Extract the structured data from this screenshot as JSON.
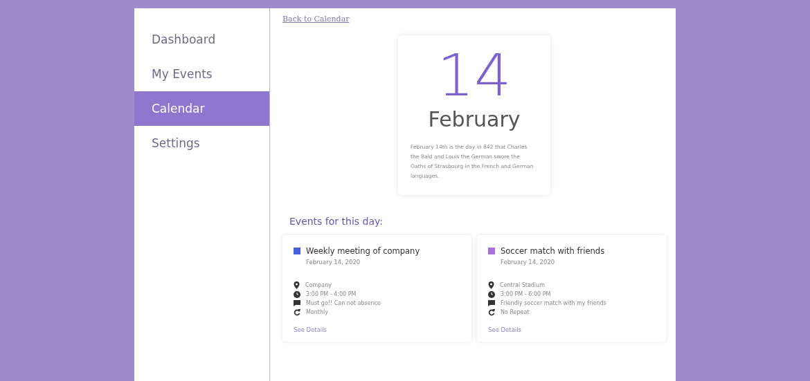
{
  "sidebar": {
    "items": [
      {
        "label": "Dashboard",
        "selected": false
      },
      {
        "label": "My Events",
        "selected": false
      },
      {
        "label": "Calendar",
        "selected": true
      },
      {
        "label": "Settings",
        "selected": false
      }
    ]
  },
  "back_link": "Back to Calendar",
  "day": {
    "number": "14",
    "month": "February",
    "description": "February 14th is the day in 842 that Charles the Bald and Louis the German swore the Oaths of Strasbourg in the French and German languages."
  },
  "events_heading": "Events for this day:",
  "events": [
    {
      "title": "Weekly meeting of company",
      "color": "#4a5fd6",
      "date": "February 14, 2020",
      "location": "Company",
      "time": "3:00 PM - 4:00 PM",
      "note": "Must go!! Can not absence",
      "repeat": "Monthly",
      "link": "See Details"
    },
    {
      "title": "Soccer match with friends",
      "color": "#a970e0",
      "date": "February 14, 2020",
      "location": "Central Stadium",
      "time": "3:00 PM - 6:00 PM",
      "note": "Friendly soccer match with my friends",
      "repeat": "No Repeat",
      "link": "See Details"
    }
  ]
}
